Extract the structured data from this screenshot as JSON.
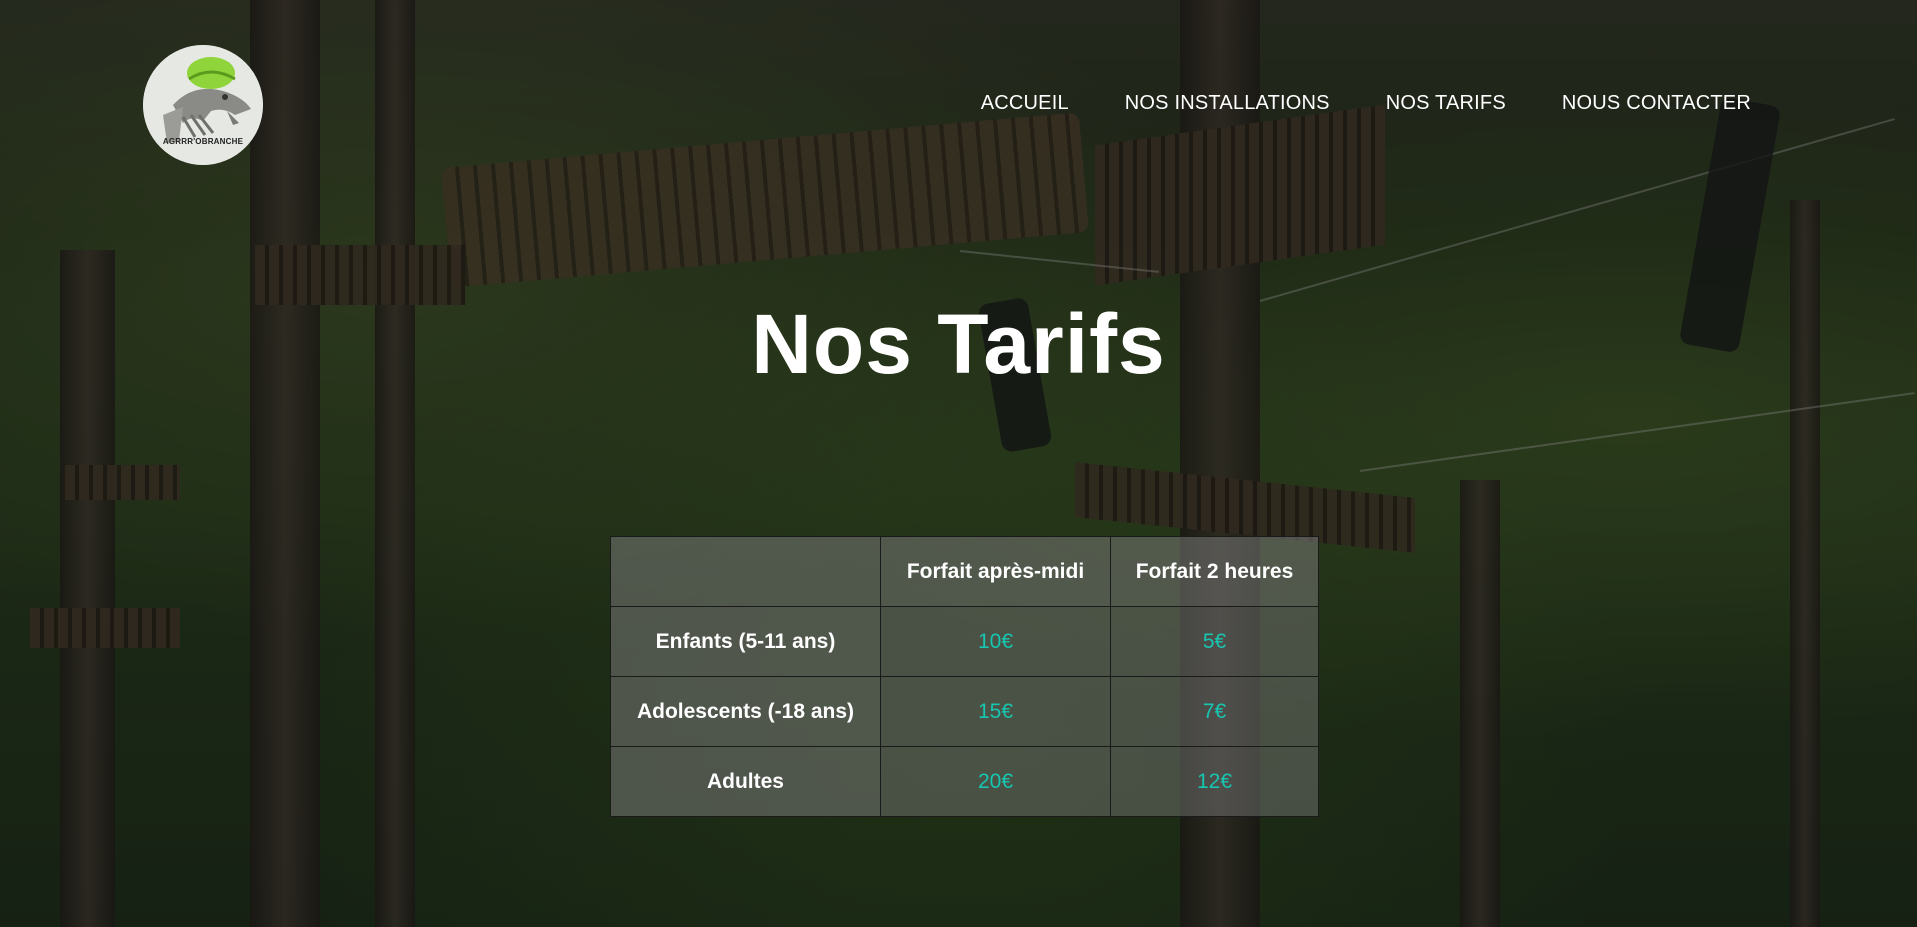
{
  "brand": {
    "logo_text": "AGRRR'OBRANCHE",
    "colors": {
      "helmet": "#8fd43a",
      "accent_price": "#17c6b1",
      "text": "#ffffff"
    }
  },
  "nav": {
    "items": [
      {
        "label": "ACCUEIL"
      },
      {
        "label": "NOS INSTALLATIONS"
      },
      {
        "label": "NOS TARIFS"
      },
      {
        "label": "NOUS CONTACTER"
      }
    ]
  },
  "main": {
    "title": "Nos Tarifs",
    "pricing_table": {
      "headers": [
        "",
        "Forfait après-midi",
        "Forfait 2 heures"
      ],
      "rows": [
        {
          "label": "Enfants (5-11 ans)",
          "prices": [
            "10€",
            "5€"
          ]
        },
        {
          "label": "Adolescents (-18 ans)",
          "prices": [
            "15€",
            "7€"
          ]
        },
        {
          "label": "Adultes",
          "prices": [
            "20€",
            "12€"
          ]
        }
      ]
    }
  }
}
